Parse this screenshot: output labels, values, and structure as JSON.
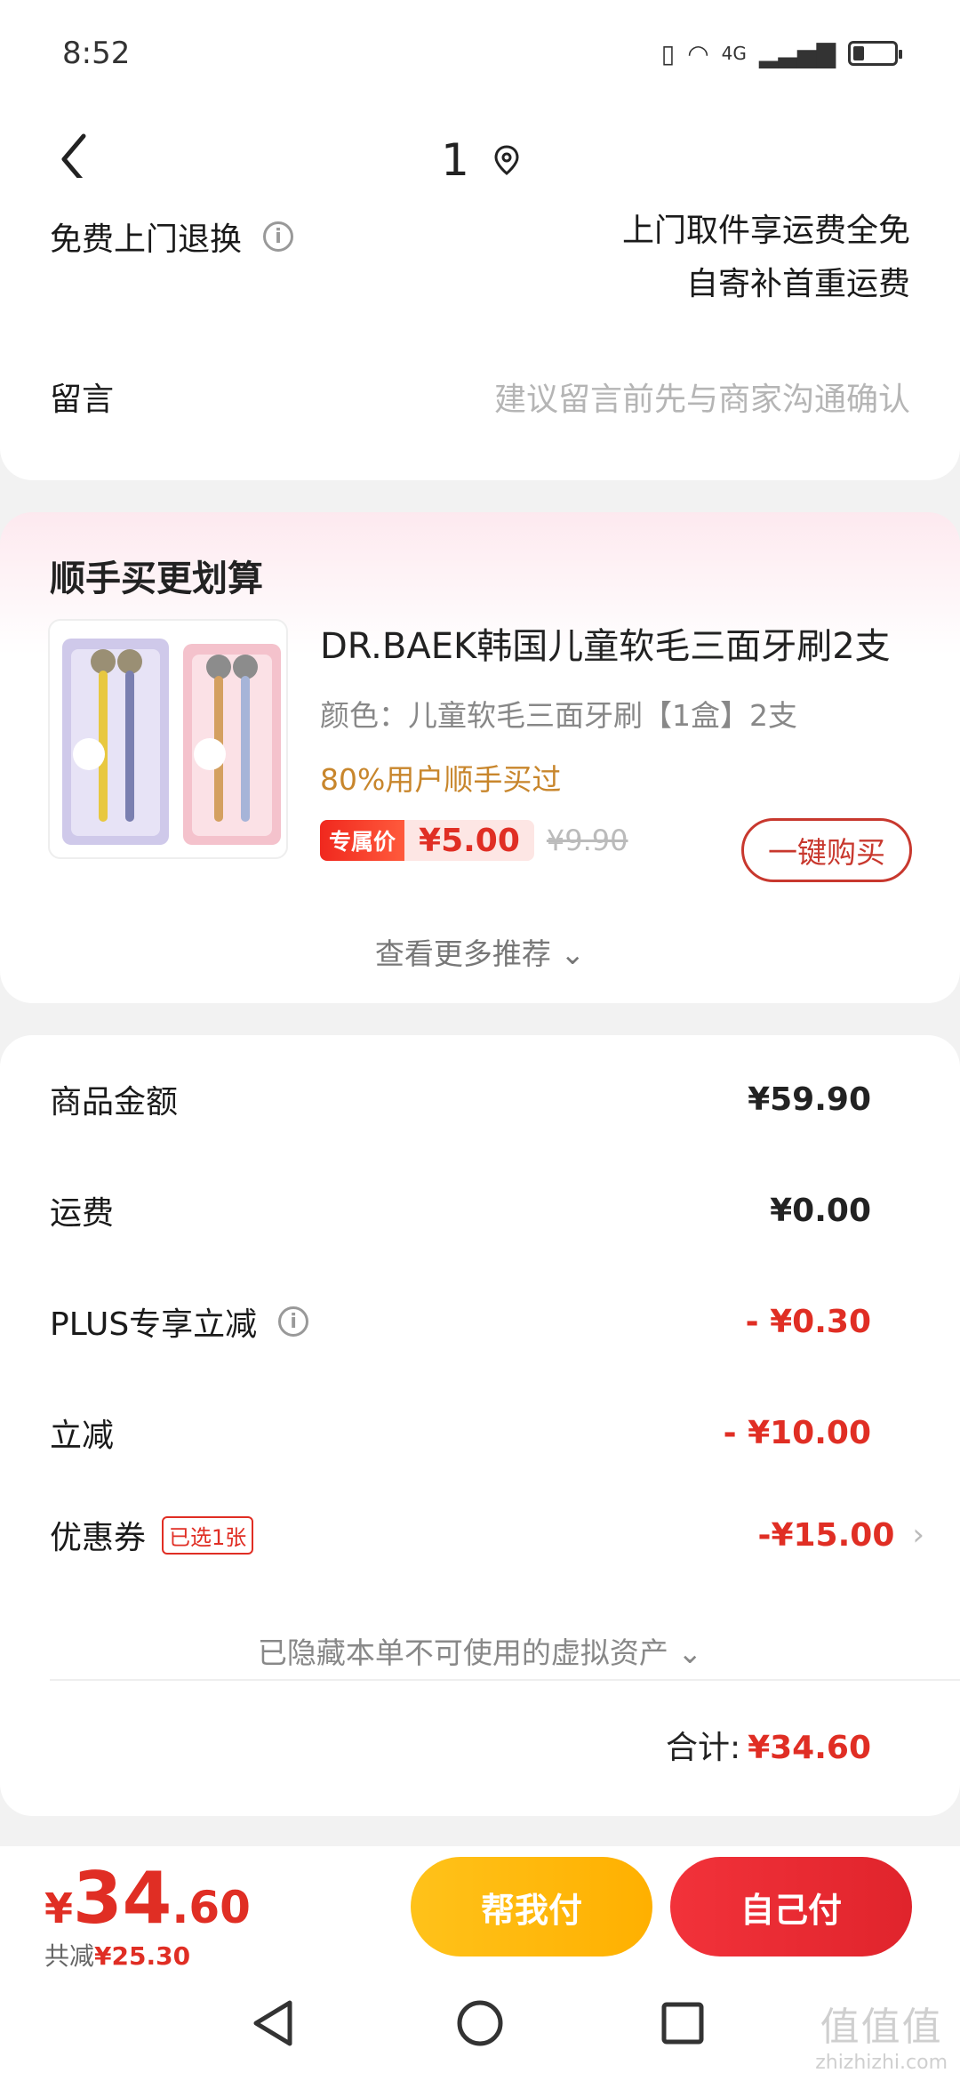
{
  "status_bar": {
    "time": "8:52",
    "network": "4G"
  },
  "header": {
    "title": "1"
  },
  "service": {
    "free_return_label": "免费上门退换",
    "free_return_desc_line1": "上门取件享运费全免",
    "free_return_desc_line2": "自寄补首重运费",
    "message_label": "留言",
    "message_placeholder": "建议留言前先与商家沟通确认"
  },
  "recommend": {
    "title": "顺手买更划算",
    "product": {
      "name": "DR.BAEK韩国儿童软毛三面牙刷2支",
      "spec": "颜色：儿童软毛三面牙刷【1盒】2支",
      "hint": "80%用户顺手买过",
      "exclusive_tag": "专属价",
      "exclusive_price": "¥5.00",
      "original_price": "¥9.90",
      "buy_button": "一键购买"
    },
    "more": "查看更多推荐"
  },
  "summary": {
    "rows": [
      {
        "label": "商品金额",
        "value": "¥59.90"
      },
      {
        "label": "运费",
        "value": "¥0.00"
      },
      {
        "label": "PLUS专享立减",
        "value": "- ¥0.30"
      },
      {
        "label": "立减",
        "value": "- ¥10.00"
      },
      {
        "label": "优惠券",
        "value": "-¥15.00",
        "tag": "已选1张"
      }
    ],
    "hidden_assets": "已隐藏本单不可使用的虚拟资产",
    "total_label": "合计:",
    "total_value": "¥34.60"
  },
  "footer": {
    "pay_yen": "¥",
    "pay_int": "34",
    "pay_dec": ".60",
    "saved_label": "共减",
    "saved_value": "¥25.30",
    "help_pay": "帮我付",
    "self_pay": "自己付"
  },
  "watermark": {
    "main": "值值值",
    "sub": "zhizhizhi.com"
  },
  "colors": {
    "accent_red": "#e02e24",
    "accent_yellow": "#ffc21a",
    "hint_orange": "#c8862c"
  }
}
